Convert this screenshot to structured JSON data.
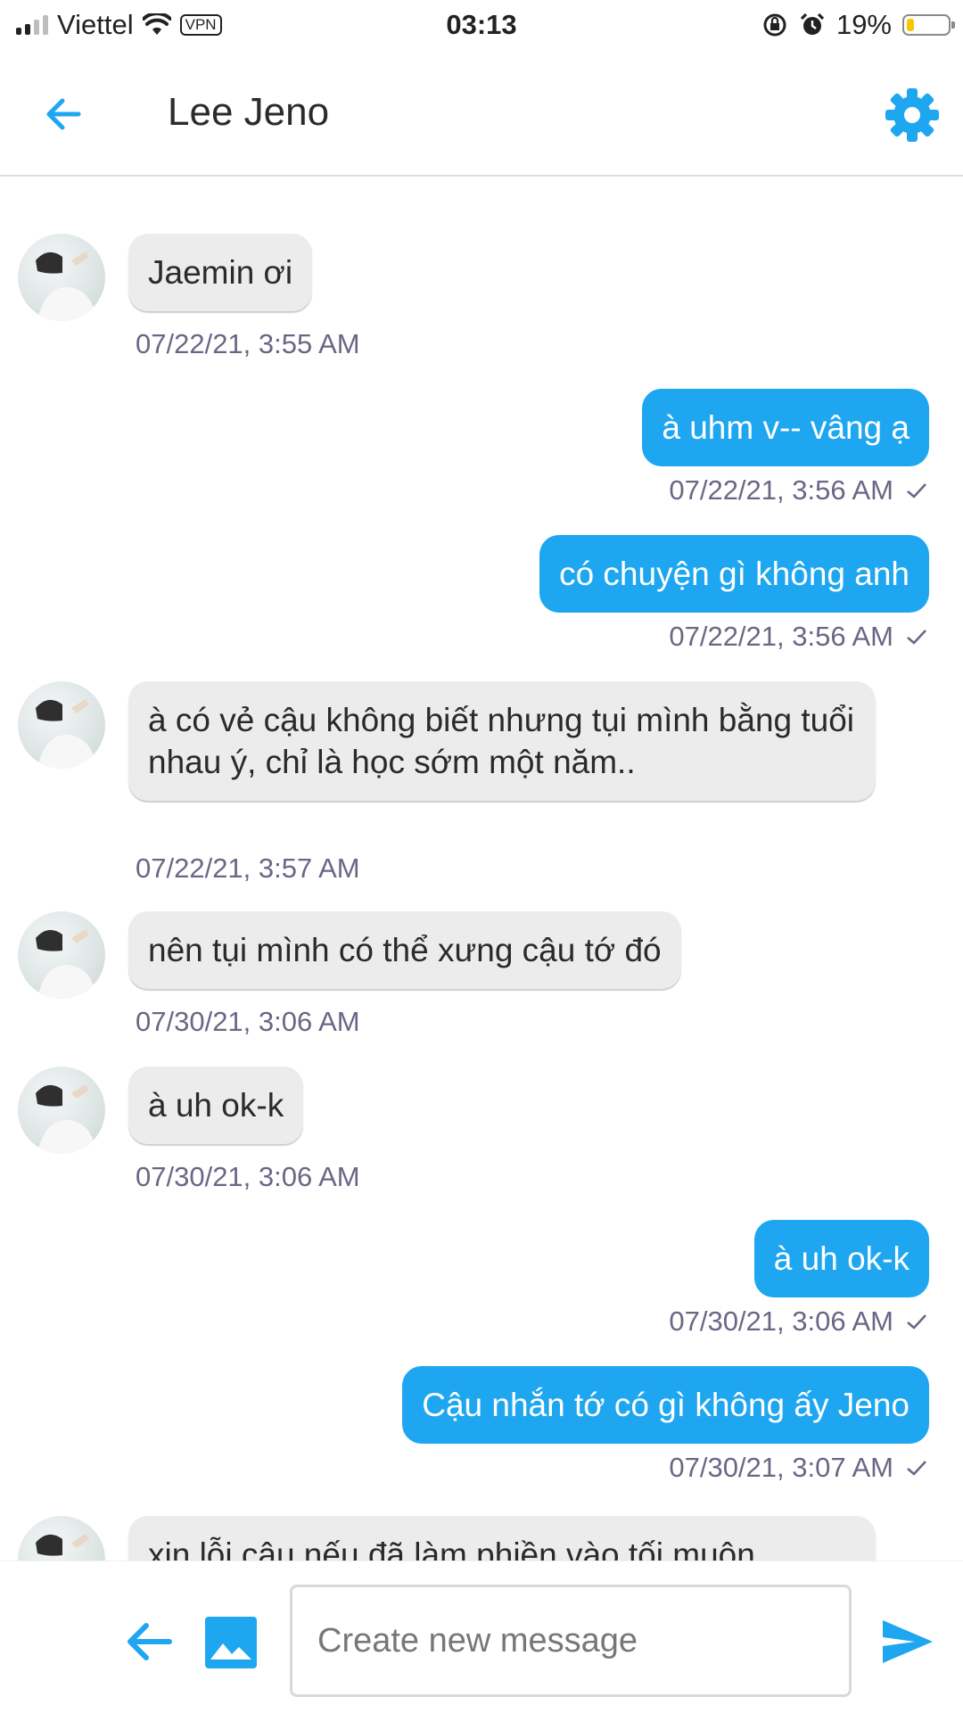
{
  "status_bar": {
    "carrier": "Viettel",
    "vpn": "VPN",
    "time": "03:13",
    "battery_percent": "19%",
    "battery_level": 0.19,
    "battery_color": "#f5c800"
  },
  "header": {
    "title": "Lee Jeno",
    "back_icon": "arrow-left-icon",
    "settings_icon": "gear-icon",
    "accent": "#1ea7f0"
  },
  "messages": [
    {
      "dir": "in",
      "text": "Jaemin ơi",
      "time": "07/22/21, 3:55 AM"
    },
    {
      "dir": "out",
      "text": "à uhm v-- vâng ạ",
      "time": "07/22/21, 3:56 AM"
    },
    {
      "dir": "out",
      "text": "có chuyện gì không anh",
      "time": "07/22/21, 3:56 AM"
    },
    {
      "dir": "in",
      "text": "à có vẻ cậu không biết nhưng tụi mình bằng tuổi nhau ý, chỉ là học sớm một năm..",
      "time": "07/22/21, 3:57 AM"
    },
    {
      "dir": "in",
      "text": "nên tụi mình có thể xưng cậu tớ đó",
      "time": "07/30/21, 3:06 AM"
    },
    {
      "dir": "in",
      "text": "à uh ok-k",
      "time": "07/30/21, 3:06 AM"
    },
    {
      "dir": "out",
      "text": "à uh ok-k",
      "time": "07/30/21, 3:06 AM"
    },
    {
      "dir": "out",
      "text": "Cậu nhắn tớ có gì không ấy Jeno",
      "time": "07/30/21, 3:07 AM"
    },
    {
      "dir": "in",
      "text": "xin lỗi cậu nếu đã làm phiền vào tối muộn"
    }
  ],
  "composer": {
    "placeholder": "Create new message",
    "back_icon": "arrow-left-icon",
    "image_icon": "image-icon",
    "send_icon": "send-icon"
  }
}
